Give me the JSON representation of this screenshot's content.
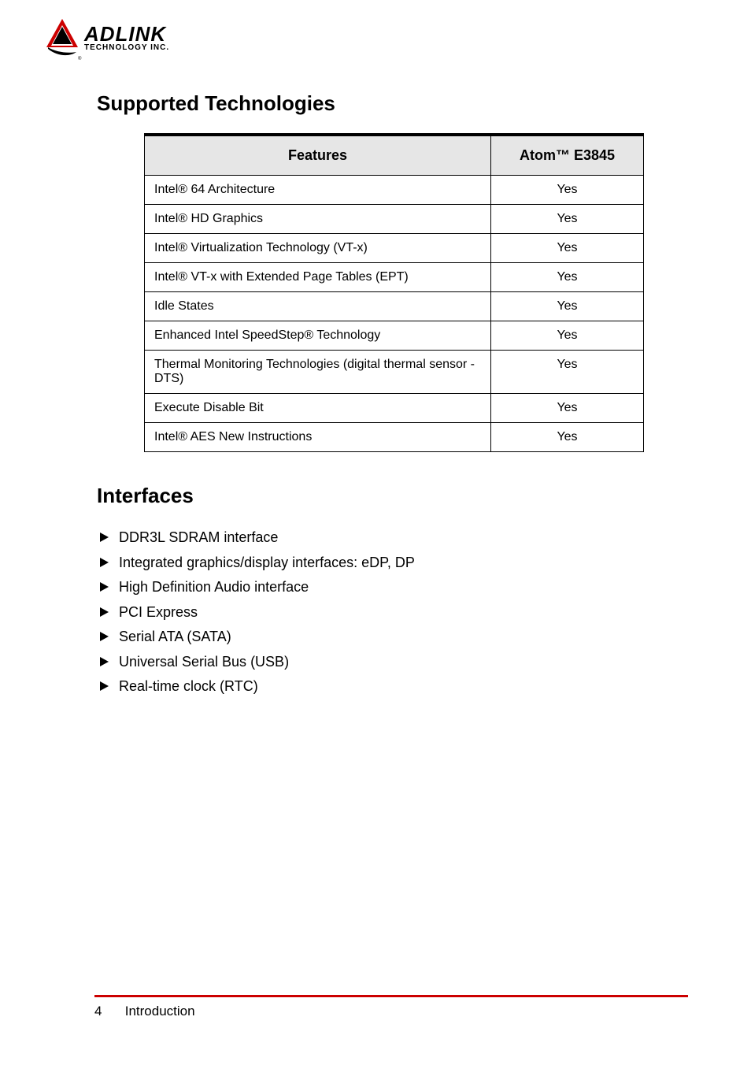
{
  "logo": {
    "brand": "ADLINK",
    "tagline": "TECHNOLOGY INC.",
    "trademark_glyph": "®"
  },
  "sections": {
    "supported_tech": {
      "title": "Supported Technologies",
      "table": {
        "headers": {
          "features": "Features",
          "cpu": "Atom™ E3845"
        },
        "rows": [
          {
            "feature": "Intel® 64 Architecture",
            "value": "Yes"
          },
          {
            "feature": "Intel® HD Graphics",
            "value": "Yes"
          },
          {
            "feature": "Intel® Virtualization Technology (VT-x)",
            "value": "Yes"
          },
          {
            "feature": "Intel® VT-x with Extended Page Tables (EPT)",
            "value": "Yes"
          },
          {
            "feature": "Idle States",
            "value": "Yes"
          },
          {
            "feature": "Enhanced Intel SpeedStep® Technology",
            "value": "Yes"
          },
          {
            "feature": "Thermal Monitoring Technologies (digital thermal sensor - DTS)",
            "value": "Yes"
          },
          {
            "feature": "Execute Disable Bit",
            "value": "Yes"
          },
          {
            "feature": "Intel® AES New Instructions",
            "value": "Yes"
          }
        ]
      }
    },
    "interfaces": {
      "title": "Interfaces",
      "items": [
        "DDR3L SDRAM interface",
        "Integrated graphics/display interfaces: eDP, DP",
        "High Definition Audio interface",
        "PCI Express",
        "Serial ATA (SATA)",
        "Universal Serial Bus (USB)",
        "Real-time clock (RTC)"
      ]
    }
  },
  "footer": {
    "page_number": "4",
    "doc_title": "Introduction"
  }
}
